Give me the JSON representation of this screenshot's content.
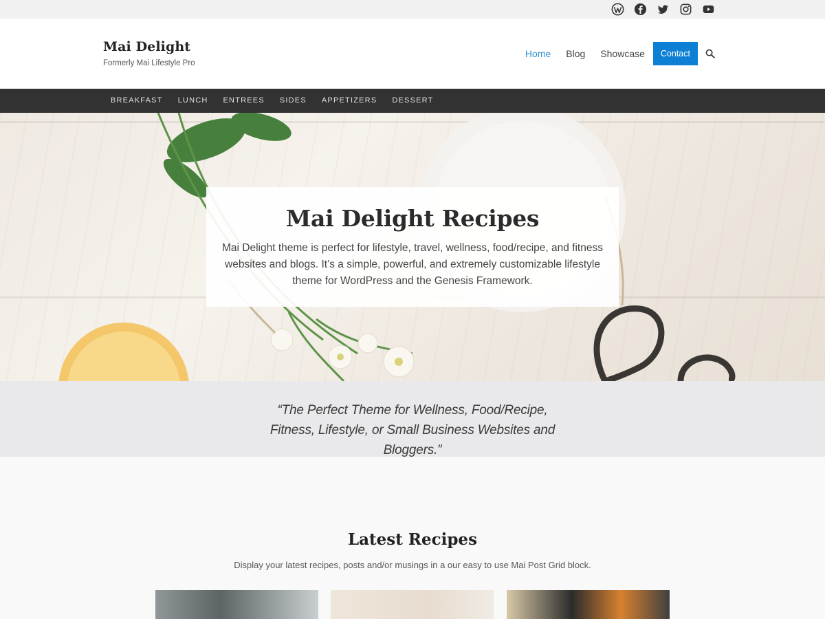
{
  "topbar": {
    "social_icons": [
      "wordpress-icon",
      "facebook-icon",
      "twitter-icon",
      "instagram-icon",
      "youtube-icon"
    ]
  },
  "header": {
    "site_title": "Mai Delight",
    "site_description": "Formerly Mai Lifestyle Pro",
    "nav": [
      {
        "label": "Home",
        "current": true
      },
      {
        "label": "Blog",
        "current": false
      },
      {
        "label": "Showcase",
        "current": false
      }
    ],
    "contact_button": "Contact",
    "search_icon": "search-icon"
  },
  "categories": [
    "Breakfast",
    "Lunch",
    "Entrees",
    "Sides",
    "Appetizers",
    "Dessert"
  ],
  "hero": {
    "title": "Mai Delight Recipes",
    "text": "Mai Delight theme is perfect for lifestyle, travel, wellness, food/recipe, and fitness websites and blogs. It’s a simple, powerful, and extremely customizable lifestyle theme for WordPress and the Genesis Framework."
  },
  "quote": {
    "text": "“The Perfect Theme for Wellness, Food/Recipe, Fitness, Lifestyle, or Small Business Websites and Bloggers.”"
  },
  "latest": {
    "title": "Latest Recipes",
    "subtitle": "Display your latest recipes, posts and/or musings in a our easy to use Mai Post Grid block."
  },
  "colors": {
    "accent": "#0d7fd4",
    "nav_current": "#2d8fd6",
    "category_bar": "#323232",
    "quote_band": "#e9e8ea"
  }
}
